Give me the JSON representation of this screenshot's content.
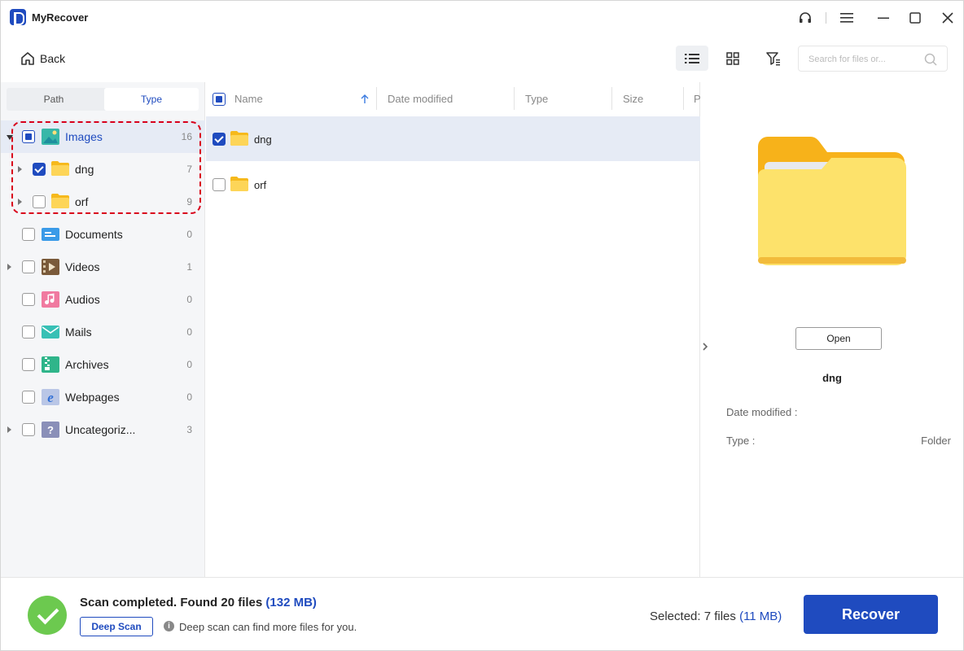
{
  "app": {
    "title": "MyRecover"
  },
  "toolbar": {
    "back_label": "Back",
    "search_placeholder": "Search for files or..."
  },
  "sidebar": {
    "tabs": [
      {
        "label": "Path"
      },
      {
        "label": "Type"
      }
    ],
    "items": [
      {
        "label": "Images",
        "count": "16"
      },
      {
        "label": "dng",
        "count": "7"
      },
      {
        "label": "orf",
        "count": "9"
      },
      {
        "label": "Documents",
        "count": "0"
      },
      {
        "label": "Videos",
        "count": "1"
      },
      {
        "label": "Audios",
        "count": "0"
      },
      {
        "label": "Mails",
        "count": "0"
      },
      {
        "label": "Archives",
        "count": "0"
      },
      {
        "label": "Webpages",
        "count": "0"
      },
      {
        "label": "Uncategoriz...",
        "count": "3"
      }
    ]
  },
  "list": {
    "columns": [
      {
        "label": "Name"
      },
      {
        "label": "Date modified"
      },
      {
        "label": "Type"
      },
      {
        "label": "Size"
      },
      {
        "label": "P"
      }
    ],
    "rows": [
      {
        "name": "dng"
      },
      {
        "name": "orf"
      }
    ]
  },
  "preview": {
    "open_label": "Open",
    "name": "dng",
    "date_label": "Date modified :",
    "date_value": "",
    "type_label": "Type :",
    "type_value": "Folder"
  },
  "status": {
    "scan_text": "Scan completed. Found 20 files",
    "scan_size": "(132 MB)",
    "deep_scan_label": "Deep Scan",
    "deep_tip": "Deep scan can find more files for you.",
    "selected_text": "Selected: 7 files",
    "selected_size": "(11 MB)",
    "recover_label": "Recover"
  },
  "colors": {
    "accent": "#1f4bbf",
    "success": "#6cc94f",
    "highlight": "#d9001b",
    "folder": "#fbc531"
  }
}
